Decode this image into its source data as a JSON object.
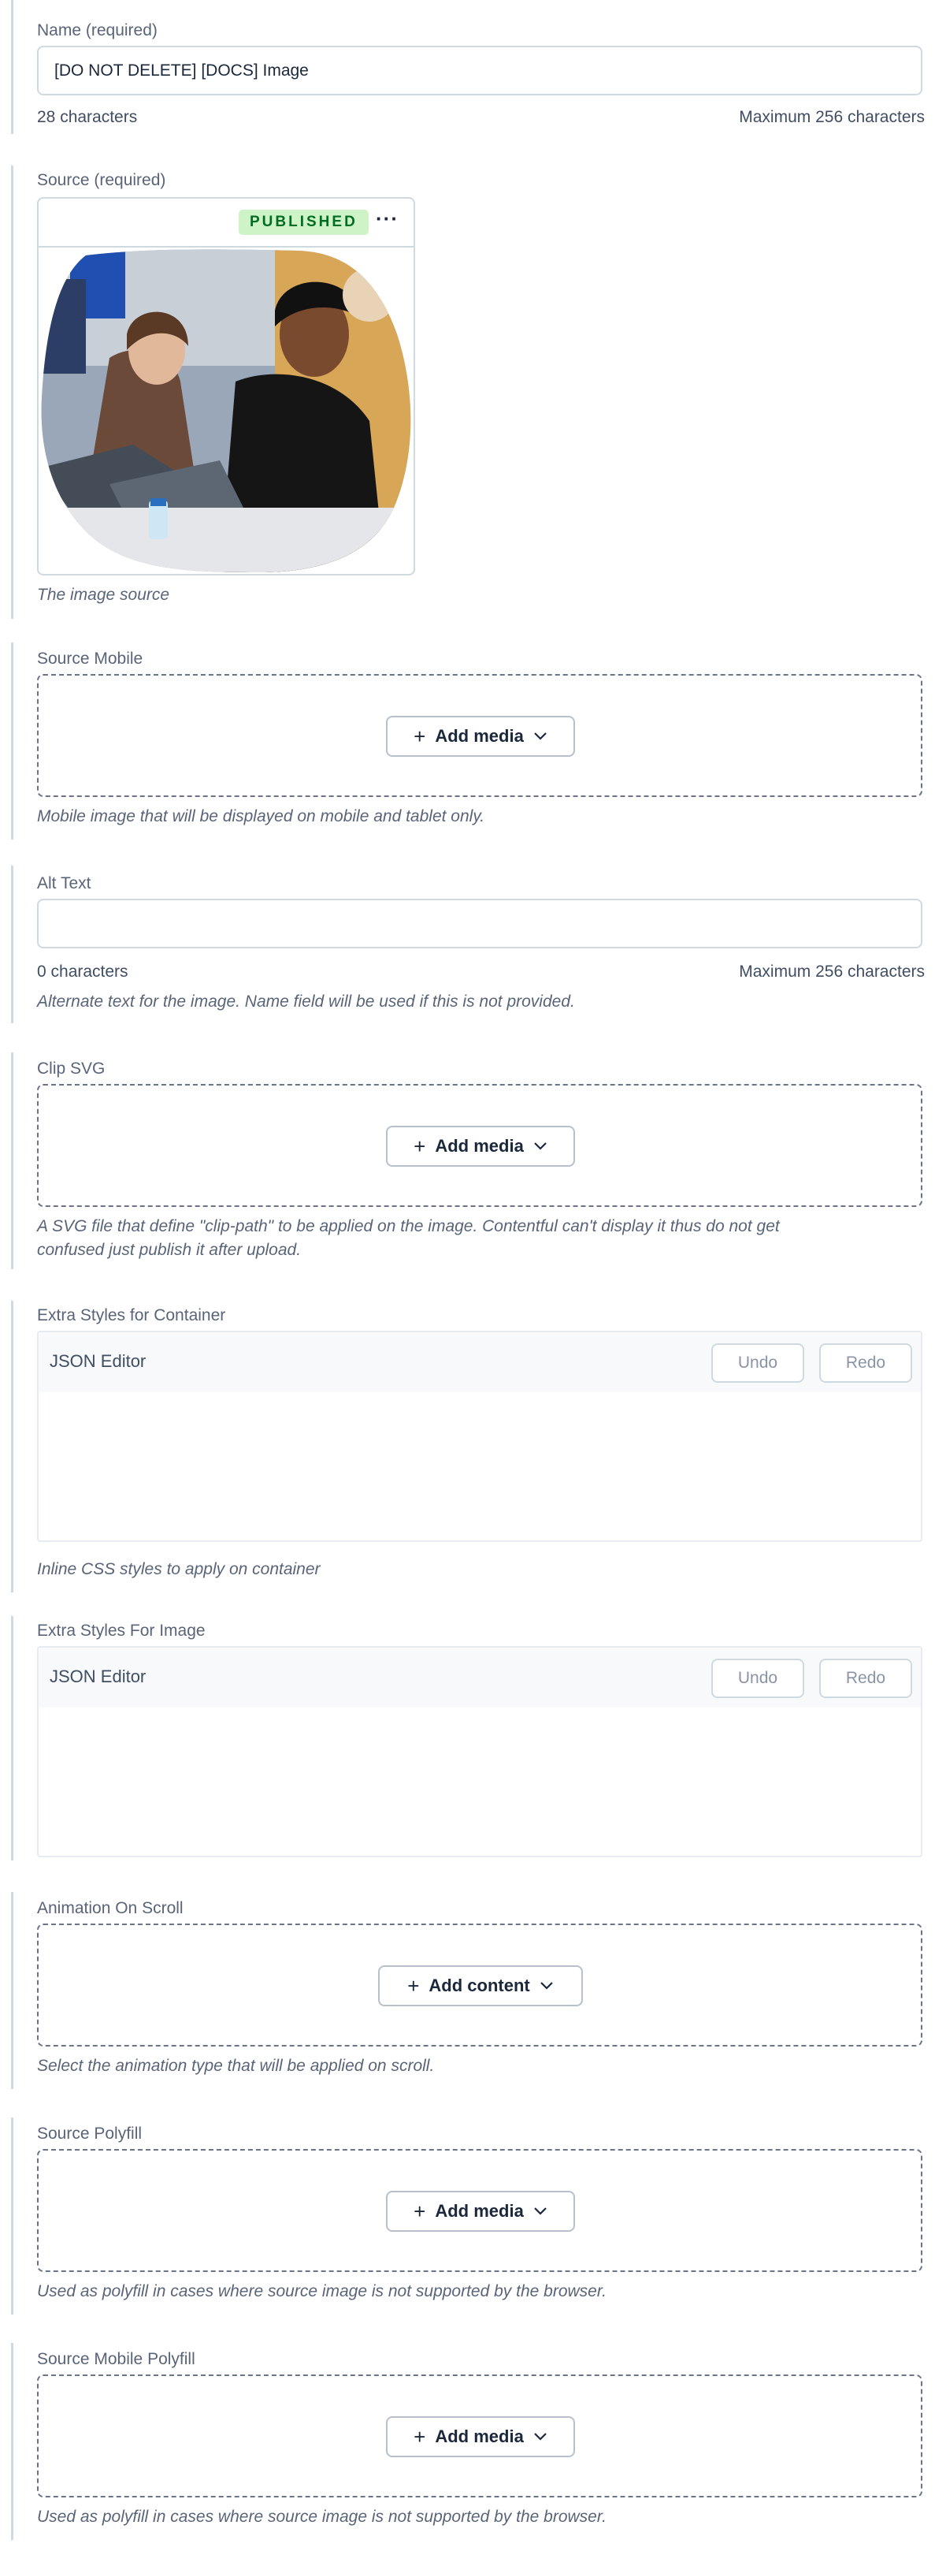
{
  "name_field": {
    "label": "Name (required)",
    "value": "[DO NOT DELETE] [DOCS] Image",
    "char_count": "28 characters",
    "max": "Maximum 256 characters"
  },
  "source_field": {
    "label": "Source (required)",
    "status": "PUBLISHED",
    "menu_icon": "ellipsis-icon",
    "menu_glyph": "···",
    "help": "The image source"
  },
  "source_mobile": {
    "label": "Source Mobile",
    "button": "Add media",
    "help": "Mobile image that will be displayed on mobile and tablet only."
  },
  "alt_text": {
    "label": "Alt Text",
    "value": "",
    "char_count": "0 characters",
    "max": "Maximum 256 characters",
    "help": "Alternate text for the image. Name field will be used if this is not provided."
  },
  "clip_svg": {
    "label": "Clip SVG",
    "button": "Add media",
    "help_line1": "A SVG file that define \"clip-path\" to be applied on the image. Contentful can't display it thus do not get",
    "help_line2": "confused just publish it after upload."
  },
  "styles_container": {
    "label": "Extra Styles for Container",
    "editor_title": "JSON Editor",
    "undo": "Undo",
    "redo": "Redo",
    "help": "Inline CSS styles to apply on container"
  },
  "styles_image": {
    "label": "Extra Styles For Image",
    "editor_title": "JSON Editor",
    "undo": "Undo",
    "redo": "Redo"
  },
  "animation": {
    "label": "Animation On Scroll",
    "button": "Add content",
    "help": "Select the animation type that will be applied on scroll."
  },
  "source_polyfill": {
    "label": "Source Polyfill",
    "button": "Add media",
    "help": "Used as polyfill in cases where source image is not supported by the browser."
  },
  "source_mobile_polyfill": {
    "label": "Source Mobile Polyfill",
    "button": "Add media",
    "help": "Used as polyfill in cases where source image is not supported by the browser."
  },
  "icons": {
    "plus": "plus-icon",
    "plus_glyph": "+",
    "chevron": "chevron-down-icon"
  },
  "colors": {
    "published_bg": "#cdf3c6",
    "published_text": "#006d23",
    "field_border": "#cfd9e0",
    "dropzone_border": "#6b7488"
  }
}
